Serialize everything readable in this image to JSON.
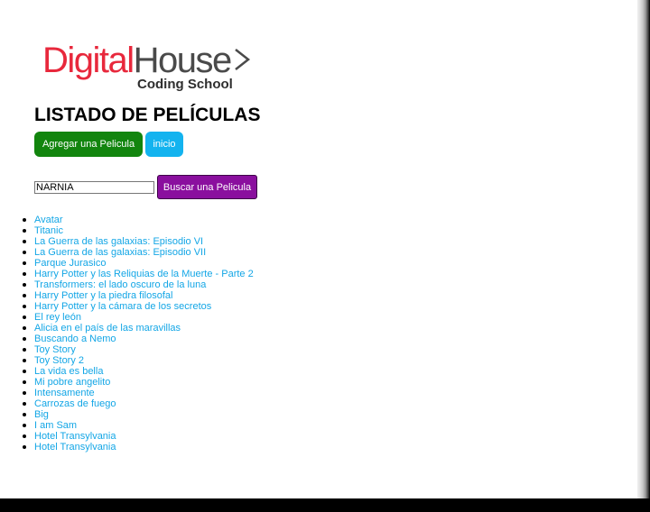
{
  "logo": {
    "brand_red": "Digital",
    "brand_gray": "House",
    "tagline": "Coding School",
    "colors": {
      "red": "#e8283c",
      "gray": "#4a4a4a"
    }
  },
  "header": {
    "title": "LISTADO DE PELÍCULAS"
  },
  "actions": {
    "add_label": "Agregar una Pelicula",
    "home_label": "inicio"
  },
  "search": {
    "value": "NARNIA",
    "button_label": "Buscar una Pelicula"
  },
  "movies": [
    "Avatar",
    "Titanic",
    "La Guerra de las galaxias: Episodio VI",
    "La Guerra de las galaxias: Episodio VII",
    "Parque Jurasico",
    "Harry Potter y las Reliquias de la Muerte - Parte 2",
    "Transformers: el lado oscuro de la luna",
    "Harry Potter y la piedra filosofal",
    "Harry Potter y la cámara de los secretos",
    "El rey león",
    "Alicia en el país de las maravillas",
    "Buscando a Nemo",
    "Toy Story",
    "Toy Story 2",
    "La vida es bella",
    "Mi pobre angelito",
    "Intensamente",
    "Carrozas de fuego",
    "Big",
    "I am Sam",
    "Hotel Transylvania",
    "Hotel Transylvania"
  ],
  "colors": {
    "add_button": "#12850e",
    "home_button": "#13b3ef",
    "search_button": "#8a0f9e",
    "link": "#13a6e6"
  }
}
